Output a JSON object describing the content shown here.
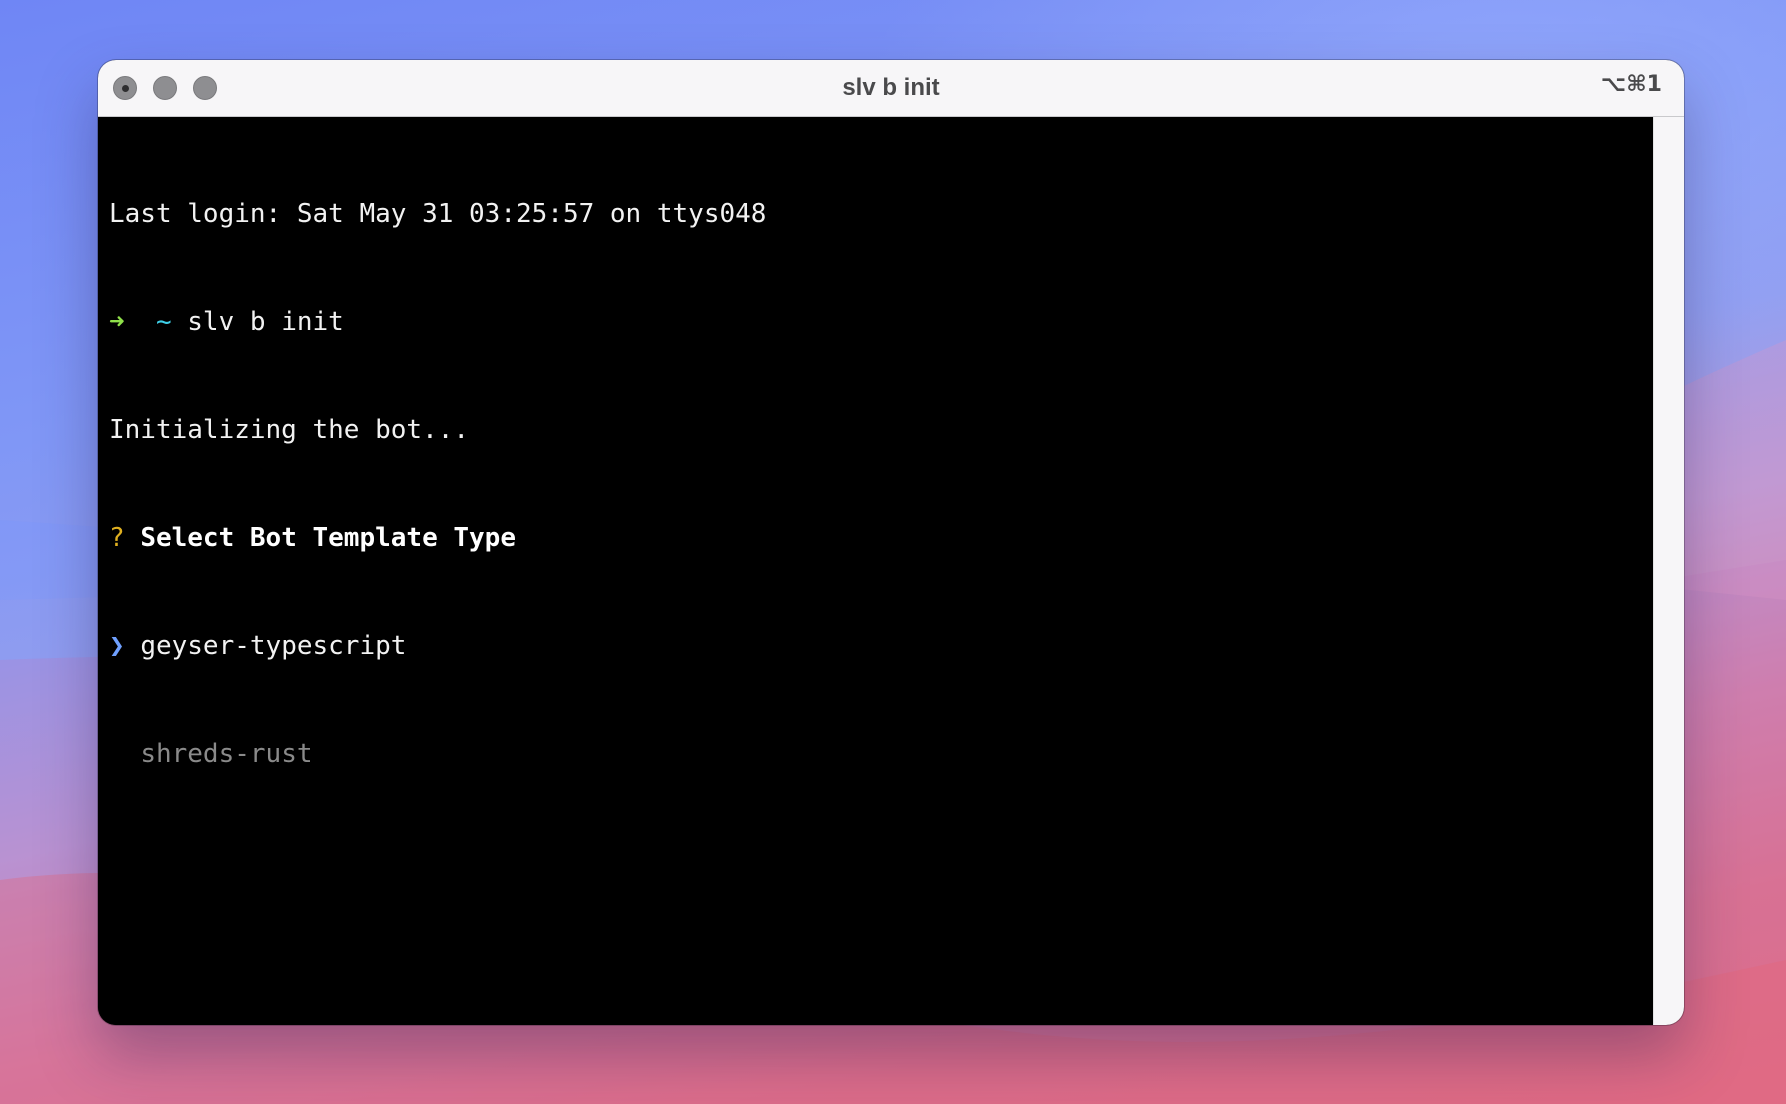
{
  "window": {
    "title": "slv b init",
    "shortcut": "⌥⌘1"
  },
  "terminal": {
    "last_login": "Last login: Sat May 31 03:25:57 on ttys048",
    "prompt_arrow": "➜",
    "prompt_dir": "~",
    "command": "slv b init",
    "status": "Initializing the bot...",
    "question_mark": "?",
    "question": "Select Bot Template Type",
    "pointer": "❯",
    "options": [
      {
        "label": "geyser-typescript",
        "selected": true
      },
      {
        "label": "shreds-rust",
        "selected": false
      }
    ]
  },
  "colors": {
    "prompt_arrow": "#8fe04a",
    "prompt_dir": "#3fd0e8",
    "question_mark": "#e0b020",
    "pointer": "#6fa0ff",
    "unselected_option": "#8a8a8a"
  },
  "icons": {
    "close": "close-button-icon",
    "minimize": "minimize-button-icon",
    "maximize": "maximize-button-icon"
  }
}
